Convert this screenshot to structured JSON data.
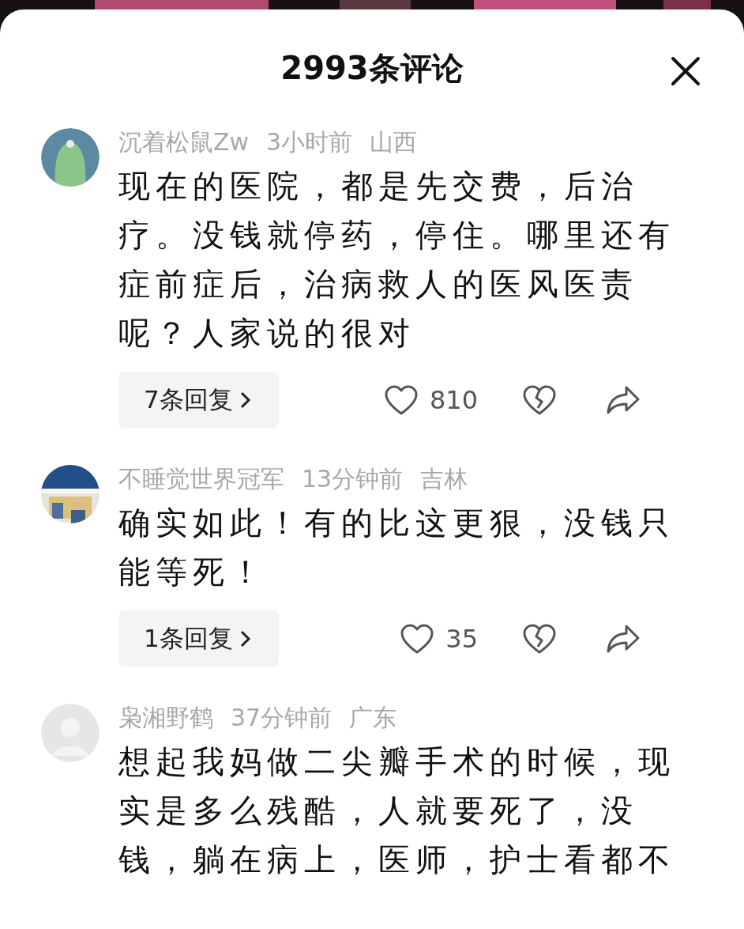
{
  "header": {
    "title": "2993条评论"
  },
  "comments": [
    {
      "avatar": {
        "kind": "cartoon"
      },
      "user": "沉着松鼠Zw",
      "time": "3小时前",
      "location": "山西",
      "text": "现在的医院，都是先交费，后治疗。没钱就停药，停住。哪里还有症前症后，治病救人的医风医责呢？人家说的很对",
      "replies": "7条回复",
      "likes": "810"
    },
    {
      "user": "不睡觉世界冠军",
      "time": "13分钟前",
      "location": "吉林",
      "text": "确实如此！有的比这更狠，没钱只能等死！",
      "replies": "1条回复",
      "likes": "35"
    },
    {
      "avatar": {
        "kind": "default"
      },
      "user": "枭湘野鹤",
      "time": "37分钟前",
      "location": "广东",
      "text": "想起我妈做二尖瓣手术的时候，现实是多么残酷，人就要死了，没钱，躺在病上，医师，护士看都不"
    }
  ]
}
